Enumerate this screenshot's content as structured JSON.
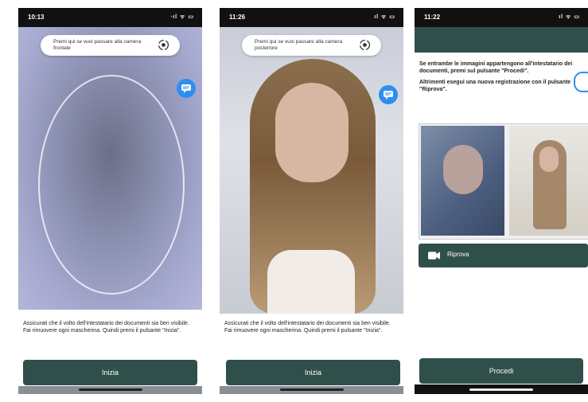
{
  "screen1": {
    "status_time": "10:13",
    "status_icons": "ᐧıl ᯤ ▭",
    "hint": "Premi qui se vuoi passare alla camera frontale",
    "instruction": "Assicurati che il volto dell'intestatario dei documenti sia ben visibile. Fai rimuovere ogni mascherina. Quindi premi il pulsante \"Inizia\".",
    "button": "Inizia"
  },
  "screen2": {
    "status_time": "11:26",
    "status_icons": "ıl ᯤ ▭",
    "hint": "Premi qui se vuoi passare alla camera posteriore",
    "instruction": "Assicurati che il volto dell'intestatario dei documenti sia ben visibile. Fai rimuovere ogni mascherina. Quindi premi il pulsante \"Inizia\".",
    "button": "Inizia"
  },
  "screen3": {
    "status_time": "11:22",
    "status_icons": "ıl ᯤ ▭",
    "text1": "Se entrambe le immagini appartengono all'intestatario dei documenti, premi sul pulsante \"Procedi\".",
    "text2": "Altrimenti esegui una nuova registrazione con il pulsante \"Riprova\".",
    "retry_button": "Riprova",
    "proceed_button": "Procedi"
  },
  "colors": {
    "primary_dark": "#2f4f4a",
    "chat_blue": "#2d8ef0"
  },
  "icons": [
    "camera-flip-icon",
    "chat-icon",
    "video-camera-icon"
  ]
}
